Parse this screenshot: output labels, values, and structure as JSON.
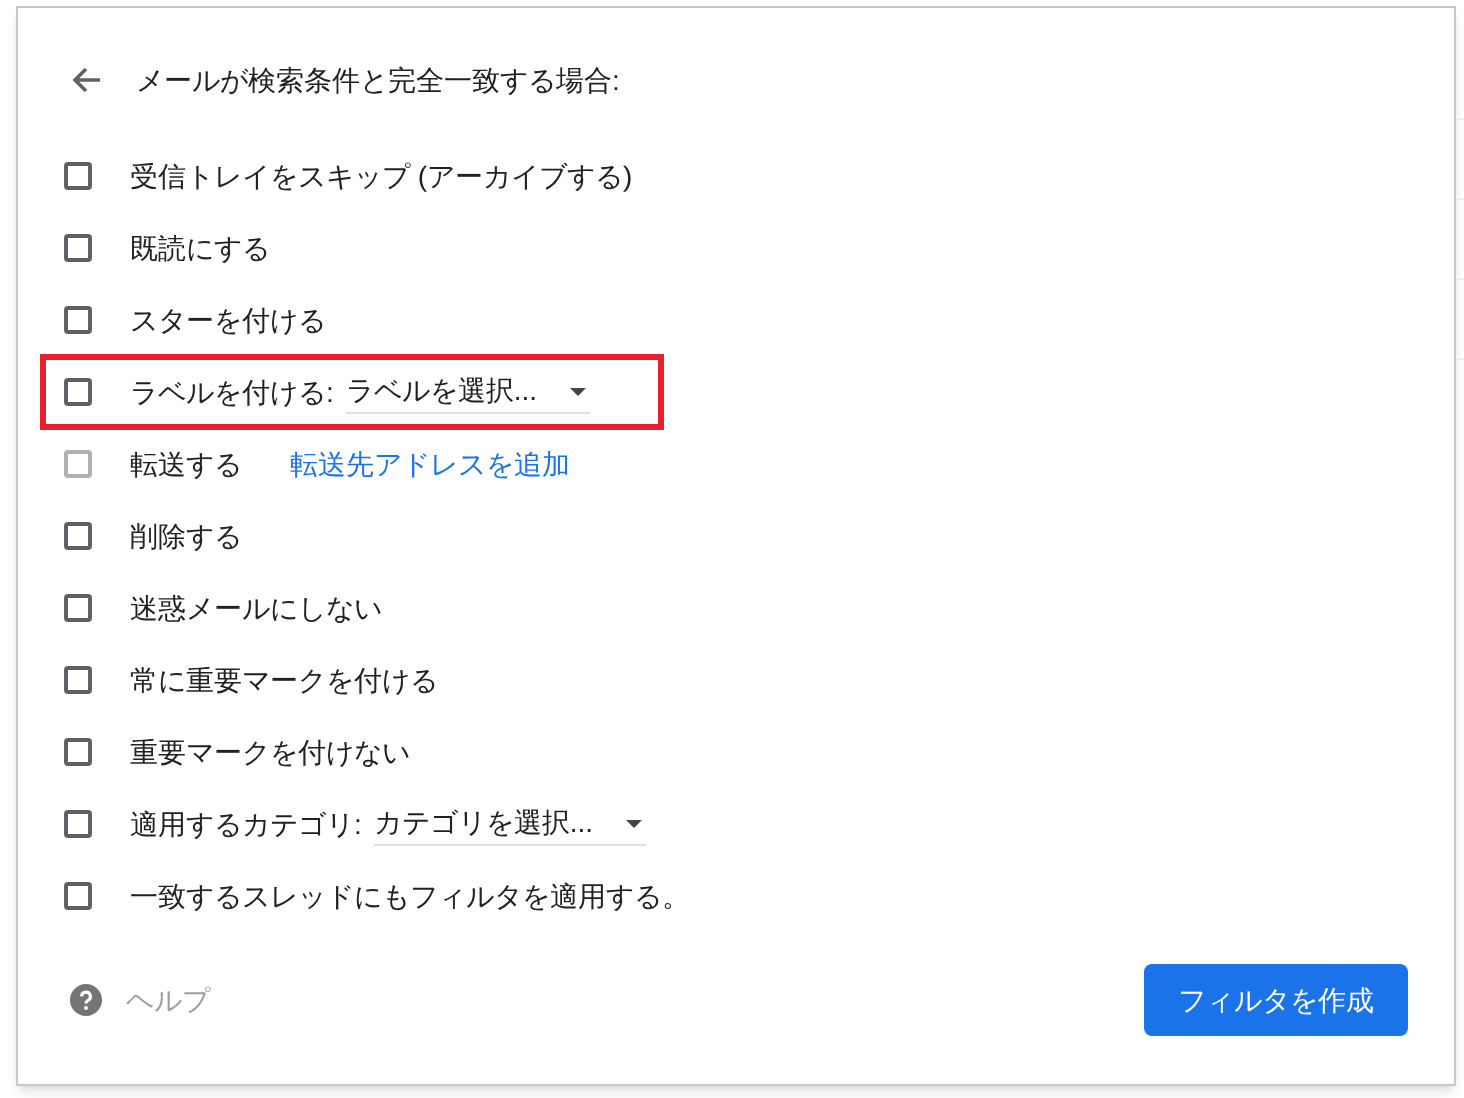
{
  "header": {
    "title": "メールが検索条件と完全一致する場合:"
  },
  "actions": [
    {
      "kind": "plain",
      "label": "受信トレイをスキップ (アーカイブする)",
      "checked": false,
      "disabled": false,
      "highlighted": false
    },
    {
      "kind": "plain",
      "label": "既読にする",
      "checked": false,
      "disabled": false,
      "highlighted": false
    },
    {
      "kind": "plain",
      "label": "スターを付ける",
      "checked": false,
      "disabled": false,
      "highlighted": false
    },
    {
      "kind": "select",
      "label": "ラベルを付ける:",
      "select": "ラベルを選択...",
      "checked": false,
      "disabled": false,
      "highlighted": true
    },
    {
      "kind": "link",
      "label": "転送する",
      "link": "転送先アドレスを追加",
      "checked": false,
      "disabled": true,
      "highlighted": false
    },
    {
      "kind": "plain",
      "label": "削除する",
      "checked": false,
      "disabled": false,
      "highlighted": false
    },
    {
      "kind": "plain",
      "label": "迷惑メールにしない",
      "checked": false,
      "disabled": false,
      "highlighted": false
    },
    {
      "kind": "plain",
      "label": "常に重要マークを付ける",
      "checked": false,
      "disabled": false,
      "highlighted": false
    },
    {
      "kind": "plain",
      "label": "重要マークを付けない",
      "checked": false,
      "disabled": false,
      "highlighted": false
    },
    {
      "kind": "select",
      "label": "適用するカテゴリ:",
      "select": "カテゴリを選択...",
      "checked": false,
      "disabled": false,
      "highlighted": false
    },
    {
      "kind": "plain",
      "label": "一致するスレッドにもフィルタを適用する。",
      "checked": false,
      "disabled": false,
      "highlighted": false
    }
  ],
  "footer": {
    "help": "ヘルプ",
    "create_button": "フィルタを作成"
  }
}
